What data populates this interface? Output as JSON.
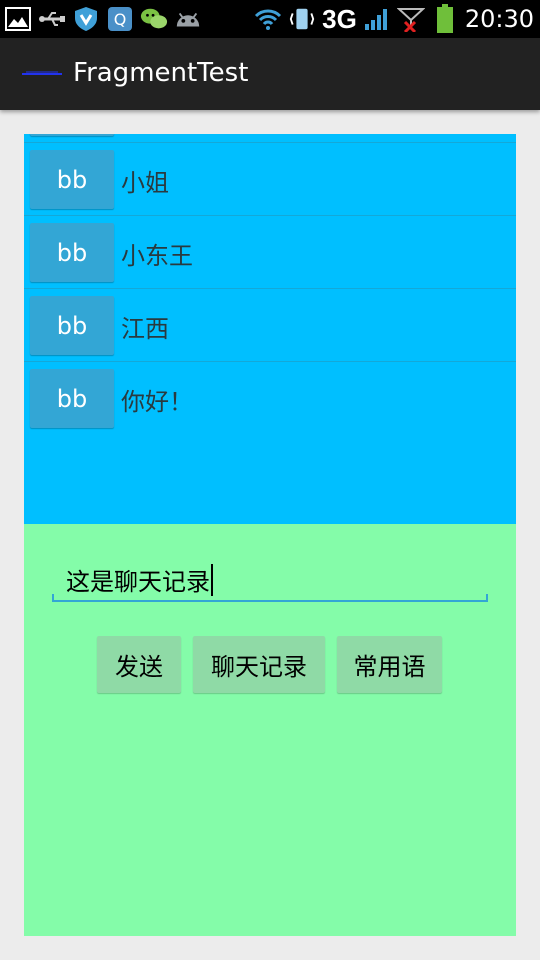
{
  "status_bar": {
    "time": "20:30",
    "network_type": "3G",
    "icons": [
      "gallery-icon",
      "usb-icon",
      "shield-icon",
      "qq-icon",
      "wechat-icon",
      "android-icon",
      "wifi-icon",
      "vibrate-icon",
      "signal-icon",
      "signal-icon",
      "battery-icon"
    ]
  },
  "action_bar": {
    "title": "FragmentTest"
  },
  "list": {
    "items": [
      {
        "button": "bb",
        "text": "小姐"
      },
      {
        "button": "bb",
        "text": "小东王"
      },
      {
        "button": "bb",
        "text": "江西"
      },
      {
        "button": "bb",
        "text": "你好！"
      }
    ]
  },
  "chat": {
    "input_value": "这是聊天记录",
    "buttons": {
      "send": "发送",
      "history": "聊天记录",
      "phrases": "常用语"
    }
  },
  "colors": {
    "list_background": "#00bfff",
    "chat_background": "#84fca9",
    "accent": "#33a6d5"
  }
}
